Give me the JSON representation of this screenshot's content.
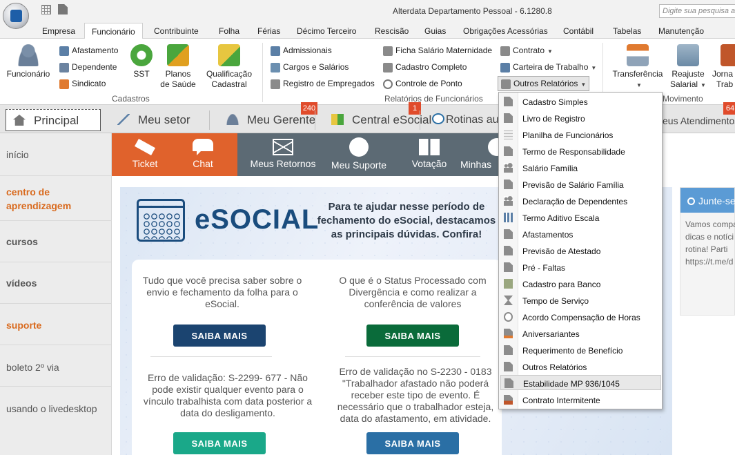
{
  "app": {
    "title": "Alterdata Departamento Pessoal - 6.1280.8",
    "search_placeholder": "Digite sua pesquisa aqui"
  },
  "ribbon_tabs": [
    "Empresa",
    "Funcionário",
    "Contribuinte",
    "Folha",
    "Férias",
    "Décimo Terceiro",
    "Rescisão",
    "Guias",
    "Obrigações Acessórias",
    "Contábil",
    "Tabelas",
    "Manutenção"
  ],
  "ribbon": {
    "cadastros": {
      "label": "Cadastros",
      "funcionario": "Funcionário",
      "afastamento": "Afastamento",
      "dependente": "Dependente",
      "sindicato": "Sindicato",
      "sst": "SST",
      "planos": [
        "Planos",
        "de Saúde"
      ],
      "qualificacao": [
        "Qualificação",
        "Cadastral"
      ]
    },
    "relatorios": {
      "label": "Relatórios de Funcionários",
      "admissionais": "Admissionais",
      "cargos": "Cargos e Salários",
      "registro": "Registro de Empregados",
      "ficha": "Ficha Salário Maternidade",
      "cadastro_completo": "Cadastro Completo",
      "controle_ponto": "Controle de Ponto",
      "contrato": "Contrato",
      "carteira": "Carteira de Trabalho",
      "outros": "Outros Relatórios"
    },
    "movimento": {
      "label": "Movimento",
      "transferencia": "Transferência",
      "reajuste": [
        "Reajuste",
        "Salarial"
      ],
      "jornada": [
        "Jorna",
        "Trab"
      ]
    }
  },
  "main_tabs": {
    "principal": "Principal",
    "meu_setor": "Meu setor",
    "meu_gerente": "Meu Gerente",
    "meu_gerente_badge": "240",
    "central_esocial": "Central eSocial",
    "central_badge": "1",
    "rotinas": "Rotinas autom",
    "meus_atendimentos": "eus Atendimentos",
    "atend_badge": "64"
  },
  "sidebar": [
    "início",
    "centro de aprendizagem",
    "cursos",
    "vídeos",
    "suporte",
    "boleto 2º via",
    "usando o livedesktop"
  ],
  "actions": [
    "Ticket",
    "Chat",
    "Meus Retornos",
    "Meu Suporte",
    "Votação",
    "Minhas"
  ],
  "banner": {
    "title": "eSOCIAL",
    "text": "Para te ajudar nesse período de fechamento do eSocial, destacamos as principais dúvidas. Confira!",
    "cards": [
      {
        "text": "Tudo que você precisa saber sobre o envio e fechamento da folha para o eSocial.",
        "button": "SAIBA MAIS"
      },
      {
        "text": "O que é o Status Processado com Divergência e como realizar a conferência de valores",
        "button": "SAIBA MAIS"
      },
      {
        "text": "Erro de validação: S-2299- 677 - Não pode existir qualquer evento para o vínculo trabalhista com data posterior a data do desligamento.",
        "button": "SAIBA MAIS"
      },
      {
        "text": "Erro de validação no S-2230 - 0183 \"Trabalhador afastado não poderá receber este tipo de evento. É necessário que o trabalhador esteja, data do afastamento, em atividade.",
        "button": "SAIBA MAIS"
      }
    ]
  },
  "right_panel": {
    "header": "Junte-se",
    "lines": [
      "Vamos compa",
      "dicas e notíci",
      "rotina!   Parti",
      "https://t.me/d"
    ]
  },
  "dropdown_items": [
    "Cadastro Simples",
    "Livro de Registro",
    "Planilha de Funcionários",
    "Termo de Responsabilidade",
    "Salário Família",
    "Previsão de Salário Família",
    "Declaração de Dependentes",
    "Termo Aditivo Escala",
    "Afastamentos",
    "Previsão de Atestado",
    "Pré - Faltas",
    "Cadastro para Banco",
    "Tempo de Serviço",
    "Acordo Compensação de Horas",
    "Aniversariantes",
    "Requerimento de Benefício",
    "Outros Relatórios",
    "Estabilidade MP 936/1045",
    "Contrato Intermitente"
  ],
  "colors": {
    "accent_orange": "#e0622c",
    "action_gray": "#5c6a74",
    "navy": "#1a4c7d",
    "green": "#0a6b3a",
    "teal": "#1aa889",
    "blue": "#2a6fa5"
  }
}
